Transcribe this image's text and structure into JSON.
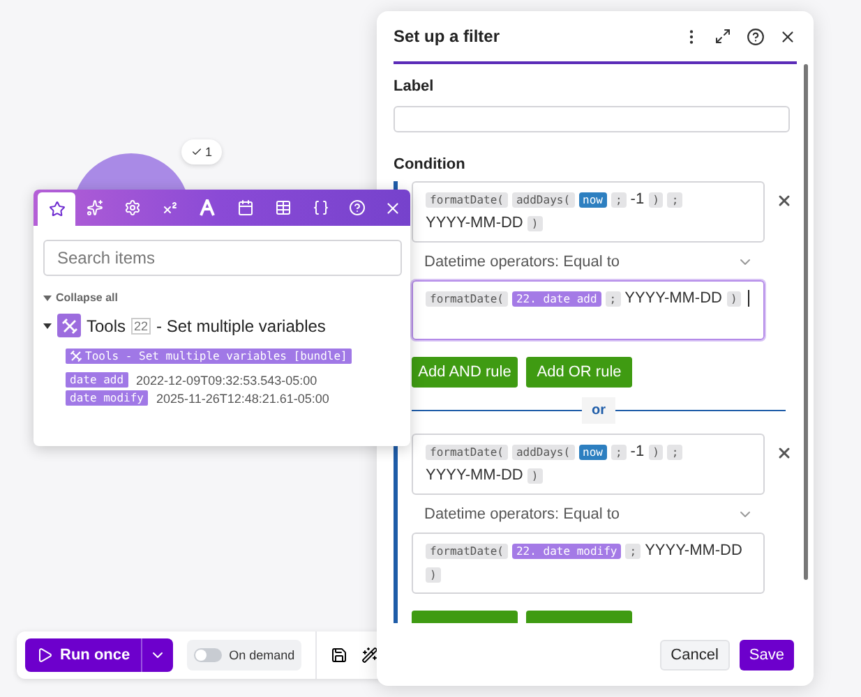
{
  "canvas": {
    "module_badge": "1"
  },
  "toolbar": {
    "run_button": "Run once",
    "schedule": {
      "label": "On demand",
      "on": false
    }
  },
  "mapping_panel": {
    "tabs": [
      {
        "kind": "favorites",
        "selected": true
      },
      {
        "kind": "ai",
        "selected": false
      },
      {
        "kind": "general",
        "selected": false
      },
      {
        "kind": "math",
        "selected": false
      },
      {
        "kind": "text",
        "selected": false
      },
      {
        "kind": "date",
        "selected": false
      },
      {
        "kind": "array",
        "selected": false
      },
      {
        "kind": "json",
        "selected": false
      }
    ],
    "search": {
      "placeholder": "Search items"
    },
    "collapse_all": "Collapse all",
    "modules": [
      {
        "name": "Tools",
        "number": "22",
        "title": "- Set multiple variables",
        "expanded": true,
        "bundle": "Tools - Set multiple variables [bundle]",
        "items": [
          {
            "name": "date add",
            "value": "2022-12-09T09:32:53.543-05:00"
          },
          {
            "name": "date modify",
            "value": "2025-11-26T12:48:21.61-05:00"
          }
        ]
      }
    ]
  },
  "filter_dialog": {
    "title": "Set up a filter",
    "label_field": {
      "label": "Label"
    },
    "condition_label": "Condition",
    "groups": [
      {
        "rules": [
          {
            "left": [
              {
                "kind": "chip",
                "text": "formatDate("
              },
              {
                "kind": "chip",
                "text": "addDays("
              },
              {
                "kind": "keyword",
                "text": "now"
              },
              {
                "kind": "chip",
                "text": ";"
              },
              {
                "kind": "text",
                "text": "-1"
              },
              {
                "kind": "chip",
                "text": ")"
              },
              {
                "kind": "chip",
                "text": ";"
              },
              {
                "kind": "text",
                "text": "YYYY-MM-DD"
              },
              {
                "kind": "chip",
                "text": ")"
              }
            ],
            "operator": "Datetime operators: Equal to",
            "right": [
              {
                "kind": "chip",
                "text": "formatDate("
              },
              {
                "kind": "item",
                "text": "22. date add"
              },
              {
                "kind": "chip",
                "text": ";"
              },
              {
                "kind": "text",
                "text": "YYYY-MM-DD"
              },
              {
                "kind": "chip",
                "text": ")"
              }
            ],
            "focused": true
          }
        ],
        "buttons": [
          {
            "kind": "full",
            "label": "Add AND rule"
          },
          {
            "kind": "full",
            "label": "Add OR rule"
          }
        ]
      },
      {
        "rules": [
          {
            "left": [
              {
                "kind": "chip",
                "text": "formatDate("
              },
              {
                "kind": "chip",
                "text": "addDays("
              },
              {
                "kind": "keyword",
                "text": "now"
              },
              {
                "kind": "chip",
                "text": ";"
              },
              {
                "kind": "text",
                "text": "-1"
              },
              {
                "kind": "chip",
                "text": ")"
              },
              {
                "kind": "chip",
                "text": ";"
              },
              {
                "kind": "text",
                "text": "YYYY-MM-DD"
              },
              {
                "kind": "chip",
                "text": ")"
              }
            ],
            "operator": "Datetime operators: Equal to",
            "right": [
              {
                "kind": "chip",
                "text": "formatDate("
              },
              {
                "kind": "item",
                "text": "22. date modify"
              },
              {
                "kind": "chip",
                "text": ";"
              },
              {
                "kind": "text",
                "text": "YYYY-MM-DD"
              },
              {
                "kind": "chip",
                "text": ")"
              }
            ],
            "focused": false
          }
        ],
        "buttons": [
          {
            "kind": "cut"
          },
          {
            "kind": "cut"
          }
        ]
      }
    ],
    "separator": "or",
    "buttons": [
      {
        "kind": "secondary",
        "label": "Cancel"
      },
      {
        "kind": "primary",
        "label": "Save"
      }
    ]
  }
}
